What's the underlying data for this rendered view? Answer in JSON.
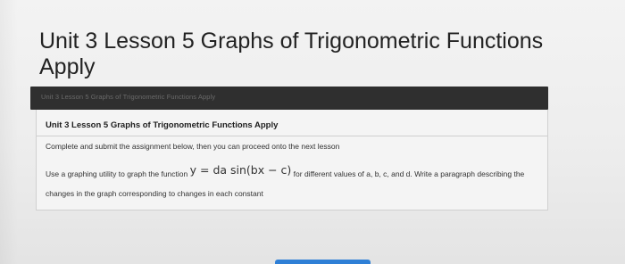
{
  "page": {
    "title": "Unit 3 Lesson 5 Graphs of Trigonometric Functions Apply"
  },
  "header_bar": {
    "breadcrumb": "Unit 3 Lesson 5 Graphs of Trigonometric Functions Apply"
  },
  "card": {
    "title": "Unit 3 Lesson 5 Graphs of Trigonometric Functions Apply",
    "instructions": "Complete and submit the assignment below, then you can proceed onto the next lesson",
    "task_prefix": "Use a graphing utility to graph the function",
    "formula": "y = da sin(bx − c)",
    "task_suffix": "for different values of a, b, c, and d. Write a paragraph describing the changes in the graph corresponding to changes in each constant"
  },
  "colors": {
    "header_bar": "#2f2f2f",
    "submit_button": "#2e7fd6",
    "background": "#eeeeee"
  }
}
